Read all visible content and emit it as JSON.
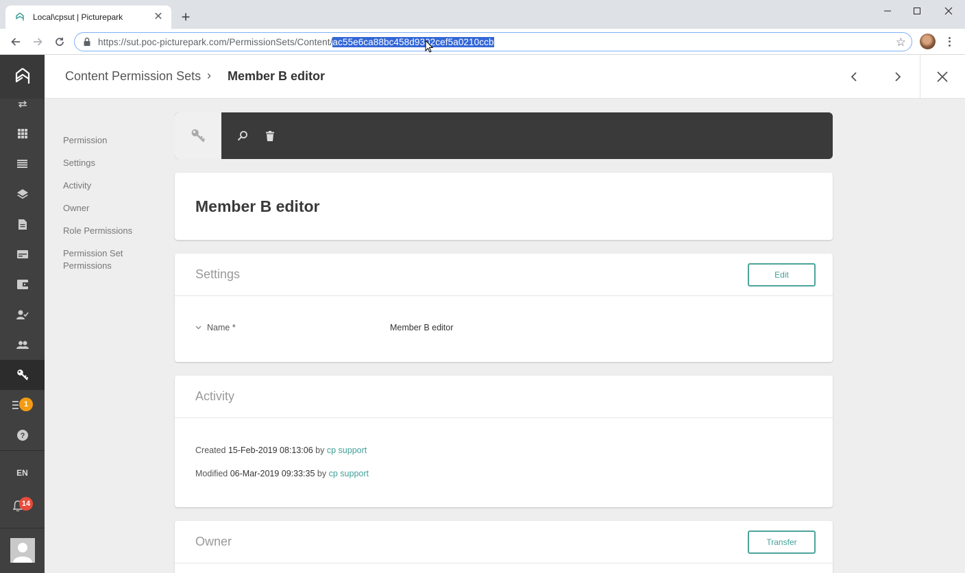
{
  "browser": {
    "tab_title": "Local\\cpsut | Picturepark",
    "url_base": "https://sut.poc-picturepark.com/PermissionSets/Content/",
    "url_selected": "ac55e6ca88bc458d9302cef5a0210ccb"
  },
  "header": {
    "breadcrumb_parent": "Content Permission Sets",
    "breadcrumb_sep": "›",
    "breadcrumb_current": "Member B editor"
  },
  "sidebar": {
    "language": "EN",
    "notification_badges": {
      "tasks": "1",
      "alerts": "14"
    },
    "accent_color": "#f39c12",
    "alert_color": "#e74c3c"
  },
  "section_nav": [
    {
      "label": "Permission"
    },
    {
      "label": "Settings"
    },
    {
      "label": "Activity"
    },
    {
      "label": "Owner"
    },
    {
      "label": "Role Permissions"
    },
    {
      "label": "Permission Set Permissions"
    }
  ],
  "main": {
    "title": "Member B editor",
    "settings": {
      "heading": "Settings",
      "edit_label": "Edit",
      "field_name_label": "Name *",
      "field_name_value": "Member B editor"
    },
    "activity": {
      "heading": "Activity",
      "created_prefix": "Created",
      "created_date": "15-Feb-2019 08:13:06",
      "created_by_word": "by",
      "created_by": "cp support",
      "modified_prefix": "Modified",
      "modified_date": "06-Mar-2019 09:33:35",
      "modified_by_word": "by",
      "modified_by": "cp support"
    },
    "owner": {
      "heading": "Owner",
      "transfer_label": "Transfer"
    }
  },
  "colors": {
    "teal": "#3f9f97",
    "sidebar_bg": "#404040",
    "toolbar_bg": "#3a3a3a"
  }
}
